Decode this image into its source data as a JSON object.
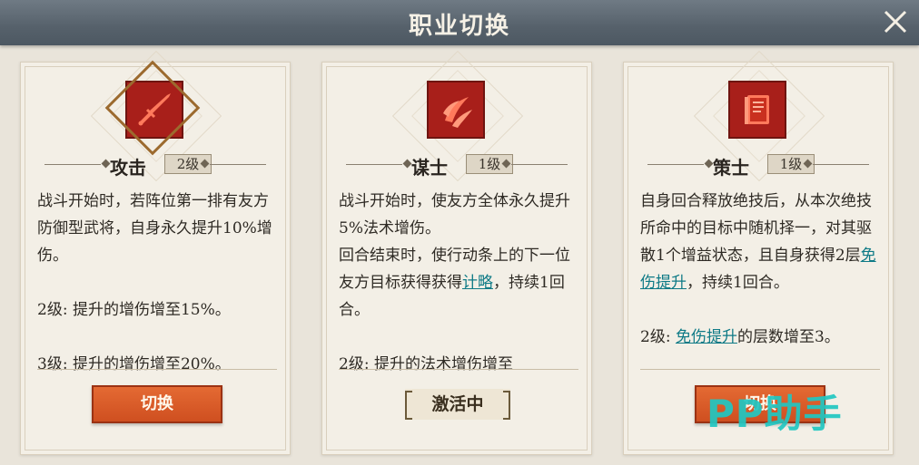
{
  "header": {
    "title": "职业切换"
  },
  "cards": [
    {
      "name": "攻击",
      "level": "2级",
      "desc": [
        "战斗开始时，若阵位第一排有友方防御型武将，自身永久提升10%增伤。"
      ],
      "level2": "2级: 提升的增伤增至15%。",
      "level3": "3级: 提升的增伤增至20%。",
      "button": "切换"
    },
    {
      "name": "谋士",
      "level": "1级",
      "desc1": "战斗开始时，使友方全体永久提升5%法术增伤。",
      "desc2_pre": "回合结束时，使行动条上的下一位友方目标获得获得",
      "desc2_kw": "计略",
      "desc2_post": "，持续1回合。",
      "level2": "2级: 提升的法术增伤增至",
      "button": "激活中"
    },
    {
      "name": "策士",
      "level": "1级",
      "desc_pre": "自身回合释放绝技后，从本次绝技所命中的目标中随机择一，对其驱散1个增益状态，且自身获得2层",
      "desc_kw": "免伤提升",
      "desc_post": "，持续1回合。",
      "level2_pre": "2级: ",
      "level2_kw": "免伤提升",
      "level2_post": "的层数增至3。",
      "button": "切换"
    }
  ],
  "watermark": "PP助手",
  "colors": {
    "accent": "#cf4f20",
    "keyword": "#0e7a86",
    "icon_bg": "#a81f1a",
    "header": "#56616b"
  },
  "icons": [
    "sword-icon",
    "claw-icon",
    "book-icon",
    "close-icon"
  ]
}
